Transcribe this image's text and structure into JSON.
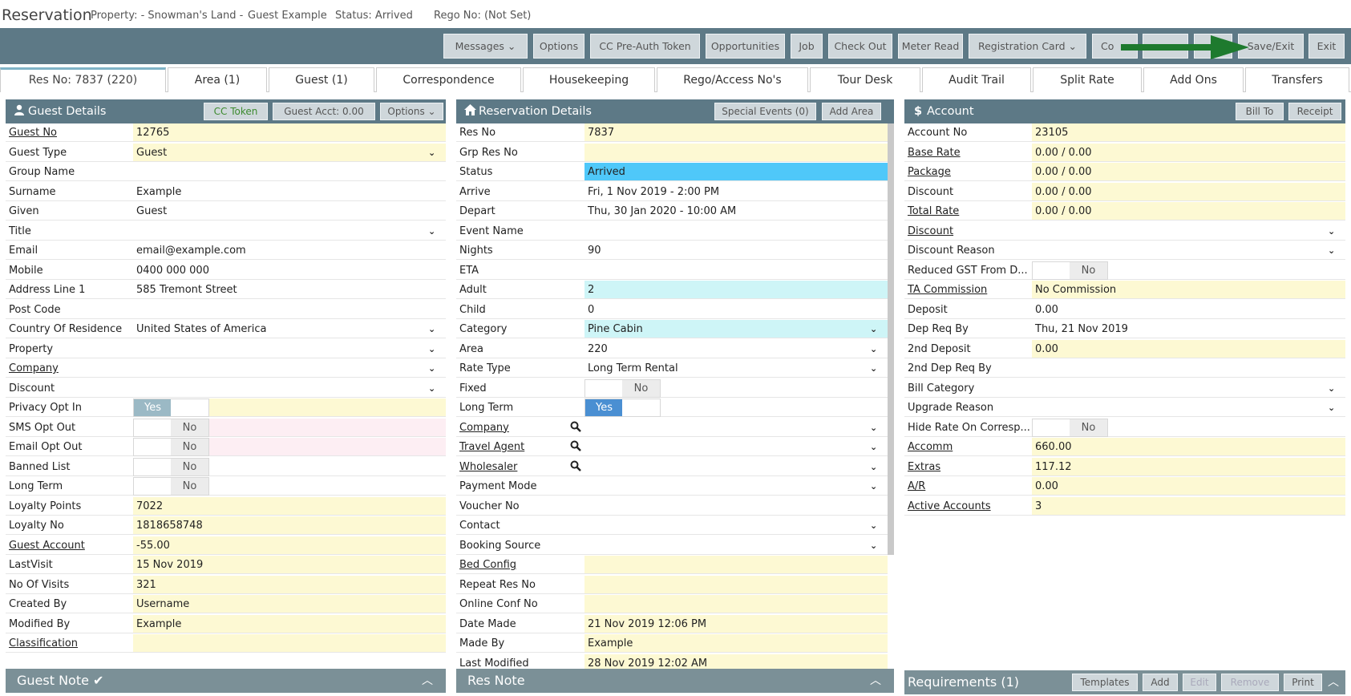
{
  "header": {
    "title": "Reservation",
    "property": "Property: - Snowman's Land - ",
    "guest": "Guest Example",
    "status": "Status: Arrived",
    "rego": "Rego No: (Not Set)"
  },
  "toolbar": {
    "buttons": [
      "Messages",
      "Options",
      "CC Pre-Auth Token",
      "Opportunities",
      "Job",
      "Check Out",
      "Meter Read",
      "Registration Card",
      "Co",
      "",
      "",
      "Save/Exit",
      "Exit"
    ]
  },
  "tabs": [
    "Res No: 7837 (220)",
    "Area (1)",
    "Guest (1)",
    "Correspondence",
    "Housekeeping",
    "Rego/Access No's",
    "Tour Desk",
    "Audit Trail",
    "Split Rate",
    "Add Ons",
    "Transfers"
  ],
  "guest": {
    "title": "Guest Details",
    "buttons": [
      "CC Token",
      "Guest Acct: 0.00",
      "Options"
    ],
    "rows": [
      {
        "label": "Guest No",
        "value": "12765"
      },
      {
        "label": "Guest Type",
        "value": "Guest"
      },
      {
        "label": "Group Name",
        "value": ""
      },
      {
        "label": "Surname",
        "value": "Example"
      },
      {
        "label": "Given",
        "value": "Guest"
      },
      {
        "label": "Title",
        "value": ""
      },
      {
        "label": "Email",
        "value": "email@example.com"
      },
      {
        "label": "Mobile",
        "value": "0400 000 000"
      },
      {
        "label": "Address Line 1",
        "value": "585 Tremont Street"
      },
      {
        "label": "Post Code",
        "value": ""
      },
      {
        "label": "Country Of Residence",
        "value": "United States of America"
      },
      {
        "label": "Property",
        "value": ""
      },
      {
        "label": "Company",
        "value": ""
      },
      {
        "label": "Discount",
        "value": ""
      },
      {
        "label": "Privacy Opt In",
        "value": "Yes"
      },
      {
        "label": "SMS Opt Out",
        "value": "No"
      },
      {
        "label": "Email Opt Out",
        "value": "No"
      },
      {
        "label": "Banned List",
        "value": "No"
      },
      {
        "label": "Long Term",
        "value": "No"
      },
      {
        "label": "Loyalty Points",
        "value": "7022"
      },
      {
        "label": "Loyalty No",
        "value": "1818658748"
      },
      {
        "label": "Guest Account",
        "value": "-55.00"
      },
      {
        "label": "LastVisit",
        "value": "15 Nov 2019"
      },
      {
        "label": "No Of Visits",
        "value": "321"
      },
      {
        "label": "Created By",
        "value": "Username"
      },
      {
        "label": "Modified By",
        "value": "Example"
      },
      {
        "label": "Classification",
        "value": ""
      }
    ],
    "note": "Guest Note"
  },
  "res": {
    "title": "Reservation Details",
    "buttons": [
      "Special Events (0)",
      "Add Area"
    ],
    "rows": [
      {
        "label": "Res No",
        "value": "7837"
      },
      {
        "label": "Grp Res No",
        "value": ""
      },
      {
        "label": "Status",
        "value": "Arrived"
      },
      {
        "label": "Arrive",
        "value": "Fri, 1 Nov 2019 - 2:00 PM"
      },
      {
        "label": "Depart",
        "value": "Thu, 30 Jan 2020 - 10:00 AM"
      },
      {
        "label": "Event Name",
        "value": ""
      },
      {
        "label": "Nights",
        "value": "90"
      },
      {
        "label": "ETA",
        "value": ""
      },
      {
        "label": "Adult",
        "value": "2"
      },
      {
        "label": "Child",
        "value": "0"
      },
      {
        "label": "Category",
        "value": "Pine Cabin"
      },
      {
        "label": "Area",
        "value": "220"
      },
      {
        "label": "Rate Type",
        "value": "Long Term Rental"
      },
      {
        "label": "Fixed",
        "value": "No"
      },
      {
        "label": "Long Term",
        "value": "Yes"
      },
      {
        "label": "Company",
        "value": ""
      },
      {
        "label": "Travel Agent",
        "value": ""
      },
      {
        "label": "Wholesaler",
        "value": ""
      },
      {
        "label": "Payment Mode",
        "value": ""
      },
      {
        "label": "Voucher No",
        "value": ""
      },
      {
        "label": "Contact",
        "value": ""
      },
      {
        "label": "Booking Source",
        "value": ""
      },
      {
        "label": "Bed Config",
        "value": ""
      },
      {
        "label": "Repeat Res No",
        "value": ""
      },
      {
        "label": "Online Conf No",
        "value": ""
      },
      {
        "label": "Date Made",
        "value": "21 Nov 2019 12:06 PM"
      },
      {
        "label": "Made By",
        "value": "Example"
      },
      {
        "label": "Last Modified",
        "value": "28 Nov 2019 12:02 AM"
      }
    ],
    "note": "Res Note"
  },
  "account": {
    "title": "Account",
    "buttons": [
      "Bill To",
      "Receipt"
    ],
    "rows": [
      {
        "label": "Account No",
        "value": "23105"
      },
      {
        "label": "Base Rate",
        "value": "0.00 / 0.00"
      },
      {
        "label": "Package",
        "value": "0.00 / 0.00"
      },
      {
        "label": "Discount",
        "value": "0.00 / 0.00"
      },
      {
        "label": "Total Rate",
        "value": "0.00 / 0.00"
      },
      {
        "label": "Discount",
        "value": ""
      },
      {
        "label": "Discount Reason",
        "value": ""
      },
      {
        "label": "Reduced GST From D...",
        "value": "No"
      },
      {
        "label": "TA Commission",
        "value": "No Commission"
      },
      {
        "label": "Deposit",
        "value": "0.00"
      },
      {
        "label": "Dep Req By",
        "value": "Thu, 21 Nov 2019"
      },
      {
        "label": "2nd Deposit",
        "value": "0.00"
      },
      {
        "label": "2nd Dep Req By",
        "value": ""
      },
      {
        "label": "Bill Category",
        "value": ""
      },
      {
        "label": "Upgrade Reason",
        "value": ""
      },
      {
        "label": "Hide Rate On Corresp...",
        "value": "No"
      },
      {
        "label": "Accomm",
        "value": "660.00"
      },
      {
        "label": "Extras",
        "value": "117.12"
      },
      {
        "label": "A/R",
        "value": "0.00"
      },
      {
        "label": "Active Accounts",
        "value": "3"
      }
    ],
    "requirements": "Requirements (1)",
    "req_buttons": [
      "Templates",
      "Add",
      "Edit",
      "Remove",
      "Print"
    ]
  },
  "colors": {
    "header": "#5d7986",
    "field": "#fdf9d3",
    "status": "#4fc8f9",
    "arrow": "#1e7a2e"
  }
}
